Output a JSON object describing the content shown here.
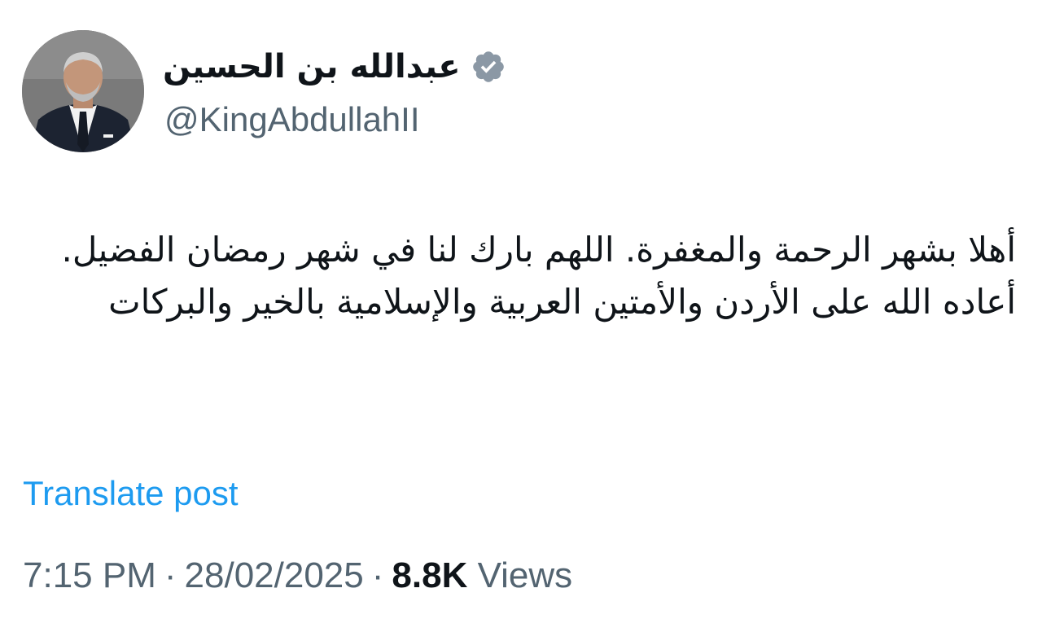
{
  "author": {
    "display_name": "عبدالله بن الحسين",
    "handle": "@KingAbdullahII",
    "verified_icon": "verified-badge-icon",
    "verified_color": "#8b98a5"
  },
  "post": {
    "text": "أهلا بشهر الرحمة والمغفرة. اللهم بارك لنا في شهر رمضان الفضيل. أعاده الله على الأردن والأمتين العربية والإسلامية بالخير والبركات",
    "translate_label": "Translate post"
  },
  "meta": {
    "time": "7:15 PM",
    "separator": "·",
    "date": "28/02/2025",
    "views_count": "8.8K",
    "views_label": "Views"
  },
  "colors": {
    "text_primary": "#0f1419",
    "text_secondary": "#536471",
    "link": "#1d9bf0"
  }
}
